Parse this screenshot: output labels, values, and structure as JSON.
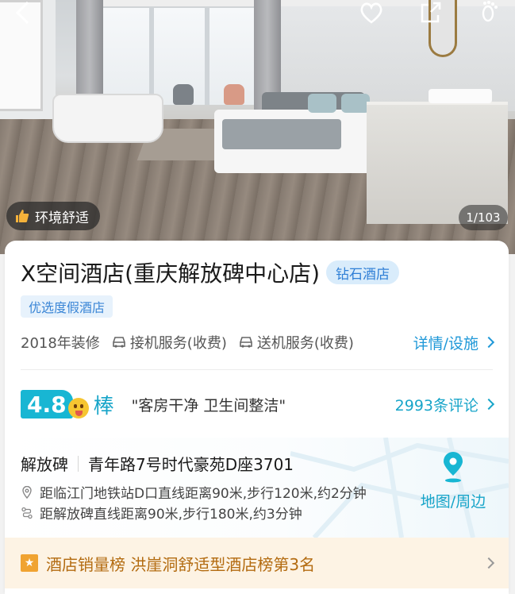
{
  "hero": {
    "environment_badge": "环境舒适",
    "photo_counter": "1/103",
    "icons": [
      "back-arrow-icon",
      "heart-icon",
      "share-icon",
      "footprint-icon"
    ]
  },
  "hotel": {
    "name": "X空间酒店(重庆解放碑中心店)",
    "grade": "钻石酒店",
    "tag": "优选度假酒店",
    "renovation": "2018年装修",
    "pickup": "接机服务(收费)",
    "dropoff": "送机服务(收费)",
    "details_link": "详情/设施"
  },
  "rating": {
    "score": "4.8",
    "word": "棒",
    "highlight": "\"客房干净  卫生间整洁\"",
    "reviews_link": "2993条评论"
  },
  "location": {
    "district": "解放碑",
    "address": "青年路7号时代豪苑D座3701",
    "metro_distance": "距临江门地铁站D口直线距离90米,步行120米,约2分钟",
    "landmark_distance": "距解放碑直线距离90米,步行180米,约3分钟",
    "map_link": "地图/周边"
  },
  "ranking": {
    "text": "酒店销量榜 洪崖洞舒适型酒店榜第3名"
  },
  "colors": {
    "accent_blue": "#18a5c9",
    "score_bg": "#18b6d3",
    "rank_text": "#b36b10",
    "rank_bg": "#fdf3e4"
  }
}
